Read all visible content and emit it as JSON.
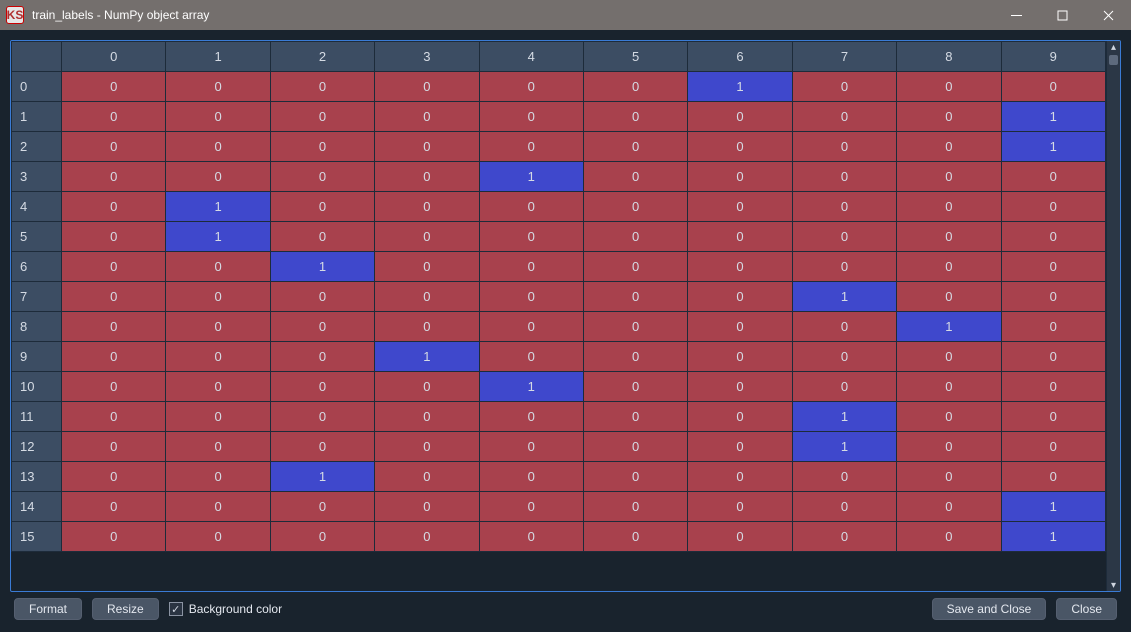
{
  "window": {
    "app_icon_text": "KS",
    "title": "train_labels - NumPy object array"
  },
  "table": {
    "columns": [
      "0",
      "1",
      "2",
      "3",
      "4",
      "5",
      "6",
      "7",
      "8",
      "9"
    ],
    "rows": [
      {
        "h": "0",
        "cells": [
          "0",
          "0",
          "0",
          "0",
          "0",
          "0",
          "1",
          "0",
          "0",
          "0"
        ]
      },
      {
        "h": "1",
        "cells": [
          "0",
          "0",
          "0",
          "0",
          "0",
          "0",
          "0",
          "0",
          "0",
          "1"
        ]
      },
      {
        "h": "2",
        "cells": [
          "0",
          "0",
          "0",
          "0",
          "0",
          "0",
          "0",
          "0",
          "0",
          "1"
        ]
      },
      {
        "h": "3",
        "cells": [
          "0",
          "0",
          "0",
          "0",
          "1",
          "0",
          "0",
          "0",
          "0",
          "0"
        ]
      },
      {
        "h": "4",
        "cells": [
          "0",
          "1",
          "0",
          "0",
          "0",
          "0",
          "0",
          "0",
          "0",
          "0"
        ]
      },
      {
        "h": "5",
        "cells": [
          "0",
          "1",
          "0",
          "0",
          "0",
          "0",
          "0",
          "0",
          "0",
          "0"
        ]
      },
      {
        "h": "6",
        "cells": [
          "0",
          "0",
          "1",
          "0",
          "0",
          "0",
          "0",
          "0",
          "0",
          "0"
        ]
      },
      {
        "h": "7",
        "cells": [
          "0",
          "0",
          "0",
          "0",
          "0",
          "0",
          "0",
          "1",
          "0",
          "0"
        ]
      },
      {
        "h": "8",
        "cells": [
          "0",
          "0",
          "0",
          "0",
          "0",
          "0",
          "0",
          "0",
          "1",
          "0"
        ]
      },
      {
        "h": "9",
        "cells": [
          "0",
          "0",
          "0",
          "1",
          "0",
          "0",
          "0",
          "0",
          "0",
          "0"
        ]
      },
      {
        "h": "10",
        "cells": [
          "0",
          "0",
          "0",
          "0",
          "1",
          "0",
          "0",
          "0",
          "0",
          "0"
        ]
      },
      {
        "h": "11",
        "cells": [
          "0",
          "0",
          "0",
          "0",
          "0",
          "0",
          "0",
          "1",
          "0",
          "0"
        ]
      },
      {
        "h": "12",
        "cells": [
          "0",
          "0",
          "0",
          "0",
          "0",
          "0",
          "0",
          "1",
          "0",
          "0"
        ]
      },
      {
        "h": "13",
        "cells": [
          "0",
          "0",
          "1",
          "0",
          "0",
          "0",
          "0",
          "0",
          "0",
          "0"
        ]
      },
      {
        "h": "14",
        "cells": [
          "0",
          "0",
          "0",
          "0",
          "0",
          "0",
          "0",
          "0",
          "0",
          "1"
        ]
      },
      {
        "h": "15",
        "cells": [
          "0",
          "0",
          "0",
          "0",
          "0",
          "0",
          "0",
          "0",
          "0",
          "1"
        ]
      }
    ]
  },
  "toolbar": {
    "format_label": "Format",
    "resize_label": "Resize",
    "bgcolor_label": "Background color",
    "bgcolor_checked": true,
    "save_close_label": "Save and Close",
    "close_label": "Close"
  }
}
